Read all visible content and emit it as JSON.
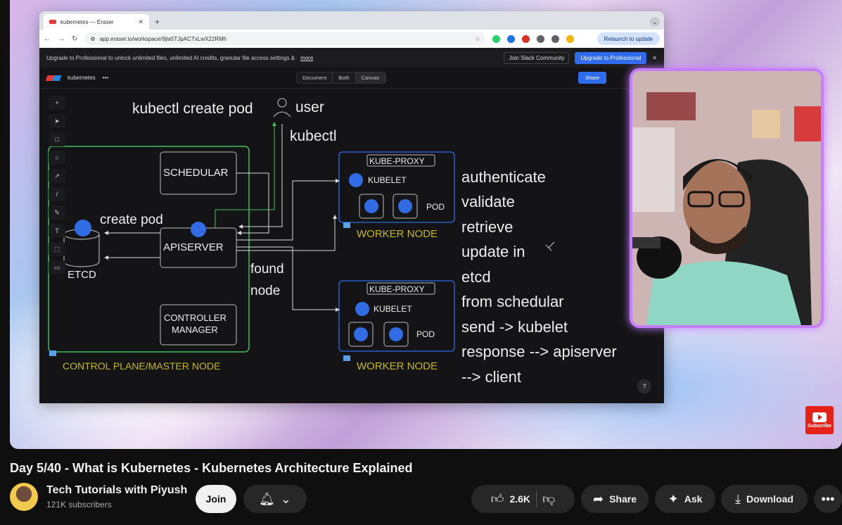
{
  "browser": {
    "tab_title": "kubernetes — Eraser",
    "url": "app.eraser.io/workspace/9jla5TJpACTxLwX22RMh",
    "relaunch_label": "Relaunch to update"
  },
  "promo": {
    "text": "Upgrade to Professional to unlock unlimited files, unlimited AI credits, granular file access settings &",
    "more_link": "more",
    "slack_label": "Join Slack Community",
    "upgrade_label": "Upgrade to Professional"
  },
  "eraser": {
    "file_name": "kubernetes",
    "views": [
      "Document",
      "Both",
      "Canvas"
    ],
    "share_label": "Share"
  },
  "diagram": {
    "command": "kubectl create pod",
    "user": "user",
    "kubectl": "kubectl",
    "create_pod": "create pod",
    "schedular": "SCHEDULAR",
    "apiserver": "APISERVER",
    "etcd": "ETCD",
    "controller_1": "CONTROLLER",
    "controller_2": "MANAGER",
    "found_1": "found",
    "found_2": "node",
    "control_plane": "CONTROL PLANE/MASTER NODE",
    "kube_proxy": "KUBE-PROXY",
    "kubelet": "KUBELET",
    "pod": "POD",
    "worker_node": "WORKER NODE",
    "steps": [
      "authenticate",
      "validate",
      "retrieve",
      "update in",
      "etcd",
      "from schedular",
      "send -> kubelet",
      "response --> apiserver",
      "--> client"
    ]
  },
  "help_label": "?",
  "subscribe_label": "Subscribe",
  "video": {
    "title": "Day 5/40 - What is Kubernetes - Kubernetes Architecture Explained",
    "channel": "Tech Tutorials with Piyush",
    "subscribers": "121K subscribers",
    "join_label": "Join",
    "likes": "2.6K",
    "share_label": "Share",
    "ask_label": "Ask",
    "download_label": "Download"
  },
  "colors": {
    "green": "#3fbf5a",
    "blue": "#2f6bed",
    "highlight": "#c7b81c"
  }
}
